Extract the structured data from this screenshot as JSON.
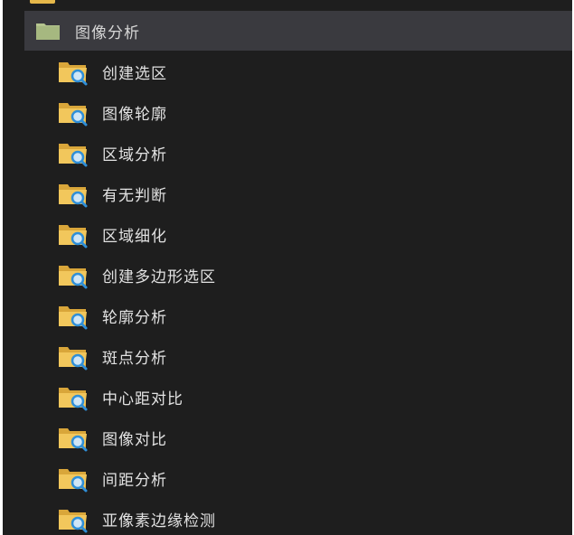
{
  "colors": {
    "panel_bg": "#1e1e1e",
    "header_bg": "#3a3a3f",
    "folder_yellow": "#f2c75c",
    "folder_dark": "#d9a63a",
    "header_folder": "#b5c58f",
    "magnifier": "#2f8fd8"
  },
  "header": {
    "icon": "folder-icon",
    "label": "图像分析"
  },
  "items": [
    {
      "label": "创建选区",
      "icon": "folder-search-icon"
    },
    {
      "label": "图像轮廓",
      "icon": "folder-search-icon"
    },
    {
      "label": "区域分析",
      "icon": "folder-search-icon"
    },
    {
      "label": "有无判断",
      "icon": "folder-search-icon"
    },
    {
      "label": "区域细化",
      "icon": "folder-search-icon"
    },
    {
      "label": "创建多边形选区",
      "icon": "folder-search-icon"
    },
    {
      "label": "轮廓分析",
      "icon": "folder-search-icon"
    },
    {
      "label": "斑点分析",
      "icon": "folder-search-icon"
    },
    {
      "label": "中心距对比",
      "icon": "folder-search-icon"
    },
    {
      "label": "图像对比",
      "icon": "folder-search-icon"
    },
    {
      "label": "间距分析",
      "icon": "folder-search-icon"
    },
    {
      "label": "亚像素边缘检测",
      "icon": "folder-search-icon"
    }
  ]
}
